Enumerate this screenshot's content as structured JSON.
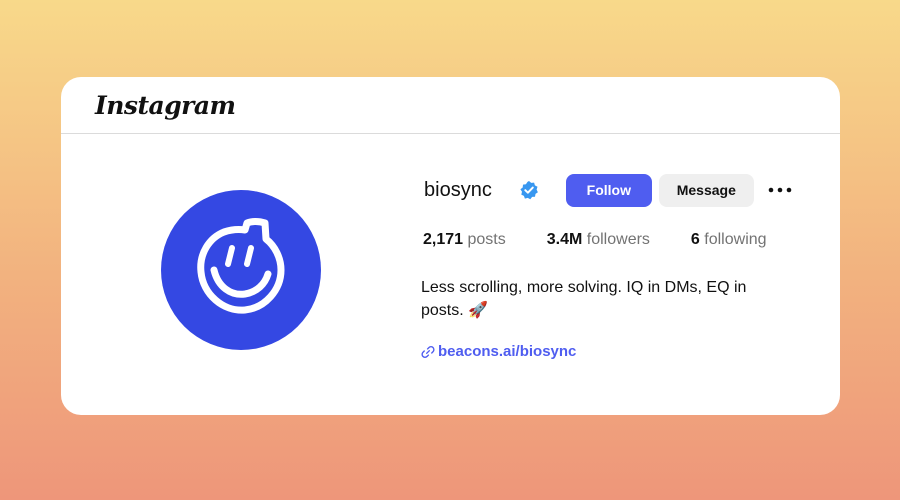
{
  "header": {
    "logo_text": "Instagram"
  },
  "profile": {
    "username": "biosync",
    "follow_label": "Follow",
    "message_label": "Message",
    "stats": {
      "posts_count": "2,171",
      "posts_label": "posts",
      "followers_count": "3.4M",
      "followers_label": "followers",
      "following_count": "6",
      "following_label": "following"
    },
    "bio": "Less scrolling, more solving. IQ in DMs, EQ in posts. 🚀",
    "link": "beacons.ai/biosync"
  },
  "icons": {
    "verified": "verified-badge-icon",
    "more": "more-options-icon",
    "link": "link-icon",
    "avatar": "smiley-logo"
  },
  "colors": {
    "accent": "#4f5df0",
    "avatar_bg": "#3448e3",
    "verified": "#3897f0"
  }
}
